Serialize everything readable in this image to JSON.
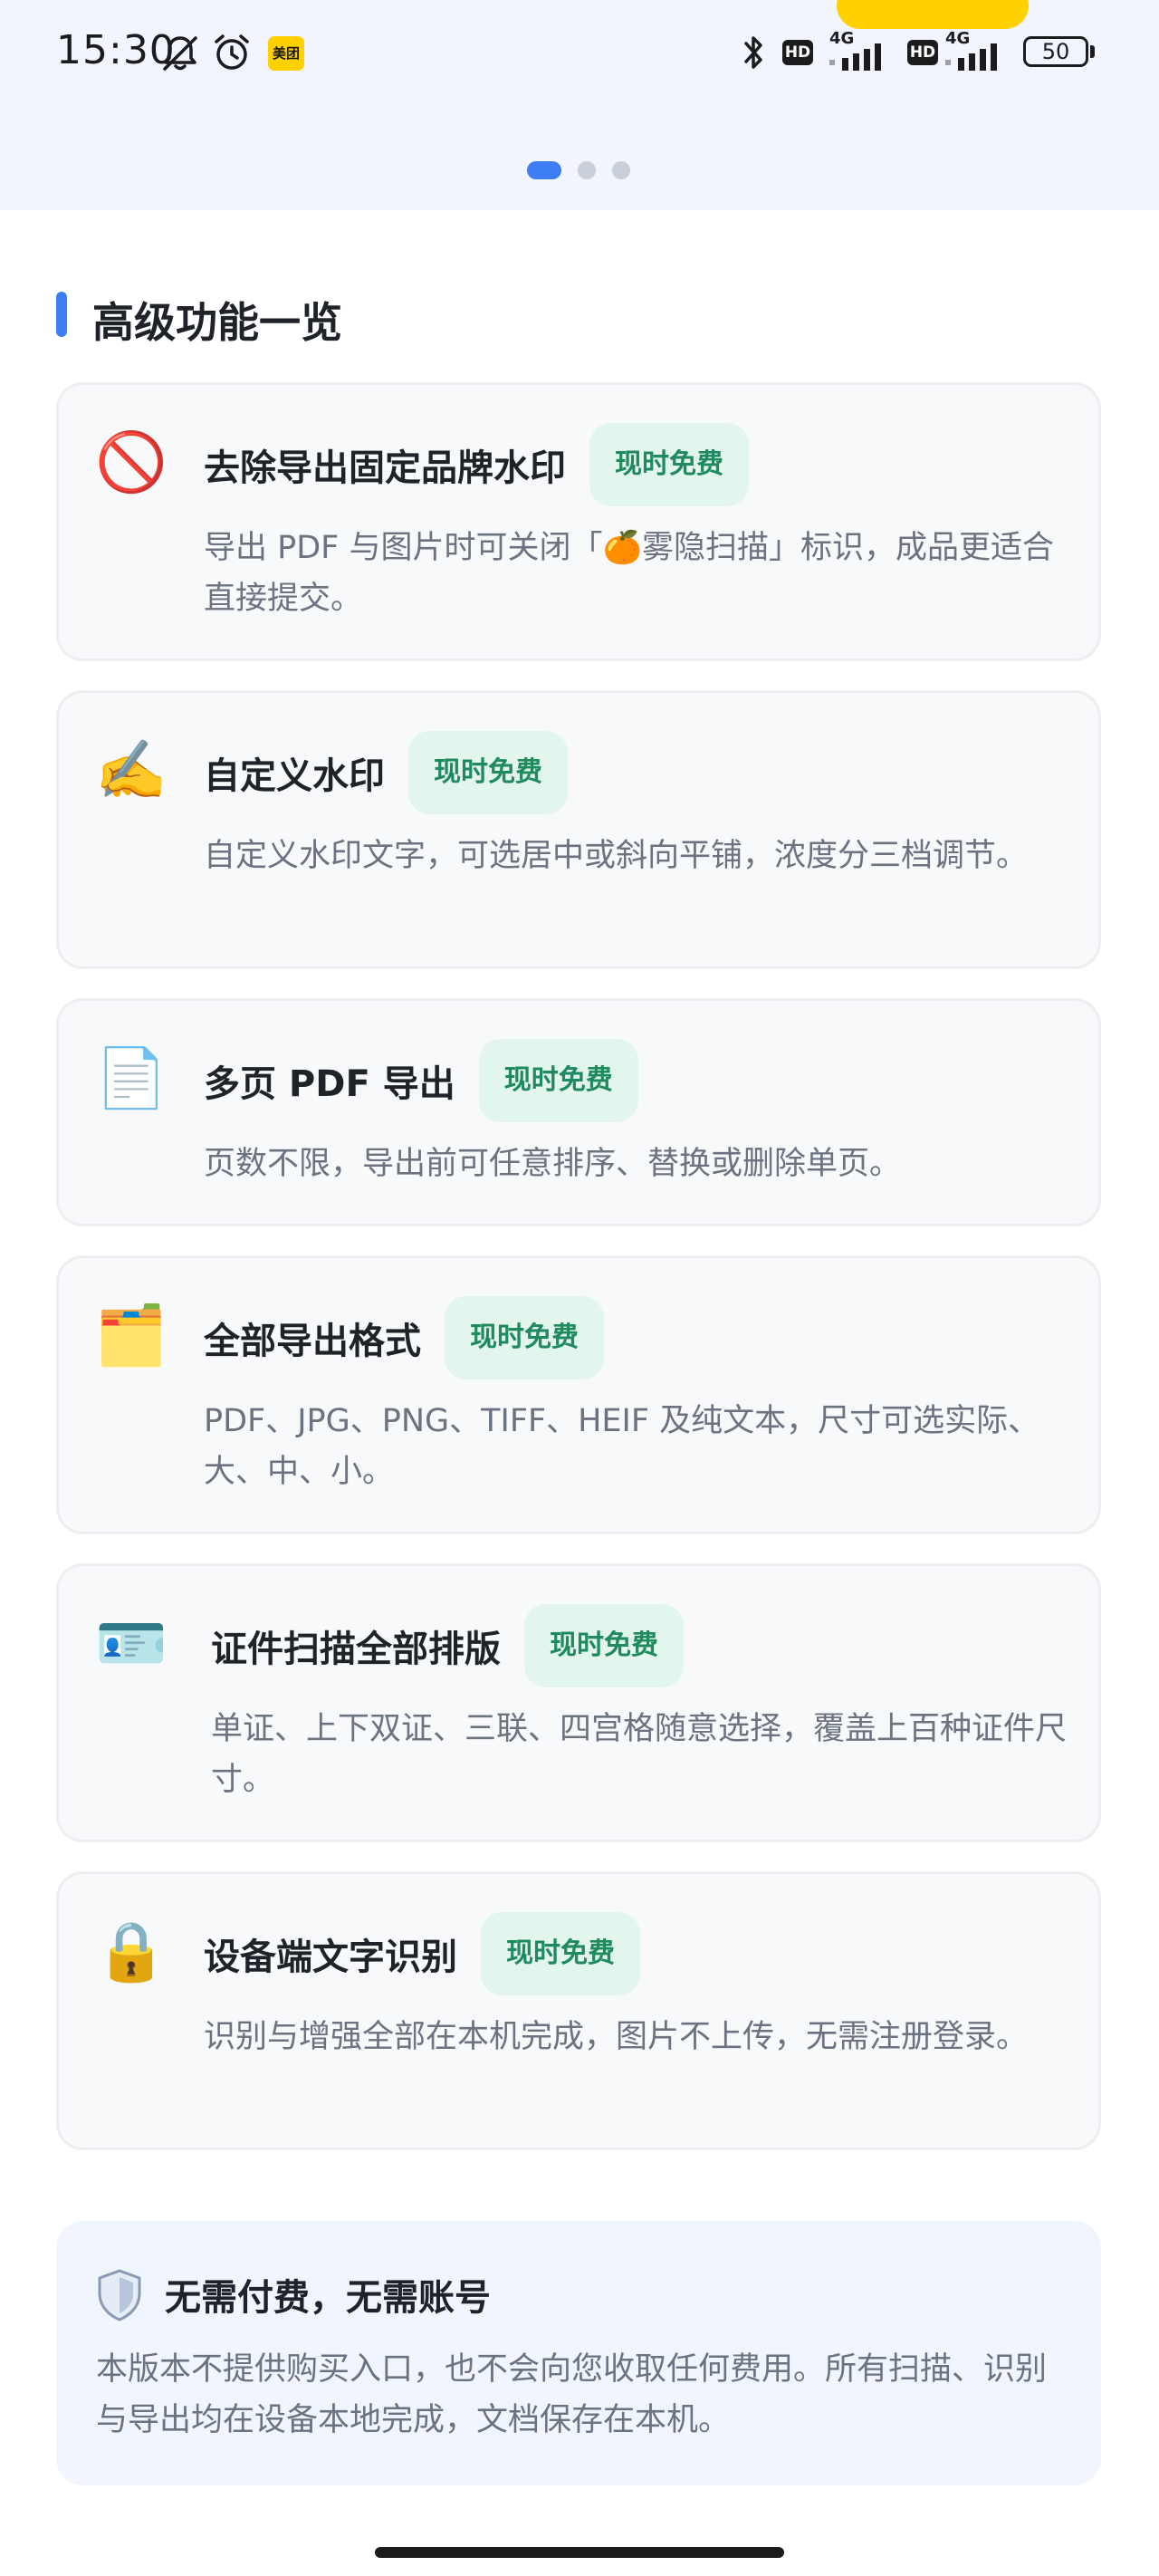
{
  "status_bar": {
    "time": "15:30",
    "app_badge": "美团",
    "hd_1": "HD",
    "network_1": "4G",
    "hd_2": "HD",
    "network_2": "4G",
    "battery": "50"
  },
  "pager": {
    "count": 3,
    "active_index": 0
  },
  "section": {
    "title": "高级功能一览"
  },
  "features": [
    {
      "icon": "no-entry-icon",
      "title": "去除导出固定品牌水印",
      "badge": "现时免费",
      "description": "导出 PDF 与图片时可关闭「🍊雾隐扫描」标识，成品更适合直接提交。"
    },
    {
      "icon": "writing-hand-icon",
      "title": "自定义水印",
      "badge": "现时免费",
      "description": "自定义水印文字，可选居中或斜向平铺，浓度分三档调节。"
    },
    {
      "icon": "document-icon",
      "title": "多页 PDF 导出",
      "badge": "现时免费",
      "description": "页数不限，导出前可任意排序、替换或删除单页。"
    },
    {
      "icon": "folder-icon",
      "title": "全部导出格式",
      "badge": "现时免费",
      "description": "PDF、JPG、PNG、TIFF、HEIF 及纯文本，尺寸可选实际、大、中、小。"
    },
    {
      "icon": "id-card-icon",
      "title": "证件扫描全部排版",
      "badge": "现时免费",
      "description": "单证、上下双证、三联、四宫格随意选择，覆盖上百种证件尺寸。"
    },
    {
      "icon": "lock-icon",
      "title": "设备端文字识别",
      "badge": "现时免费",
      "description": "识别与增强全部在本机完成，图片不上传，无需注册登录。"
    }
  ],
  "notice": {
    "icon": "shield-icon",
    "title": "无需付费，无需账号",
    "description": "本版本不提供购买入口，也不会向您收取任何费用。所有扫描、识别与导出均在设备本地完成，文档保存在本机。"
  },
  "colors": {
    "accent": "#3e7ef5",
    "badge_bg": "#e3f6ee",
    "badge_text": "#1f8a5c",
    "card_bg": "#f8f9fb",
    "notice_bg": "#f1f5fe"
  }
}
